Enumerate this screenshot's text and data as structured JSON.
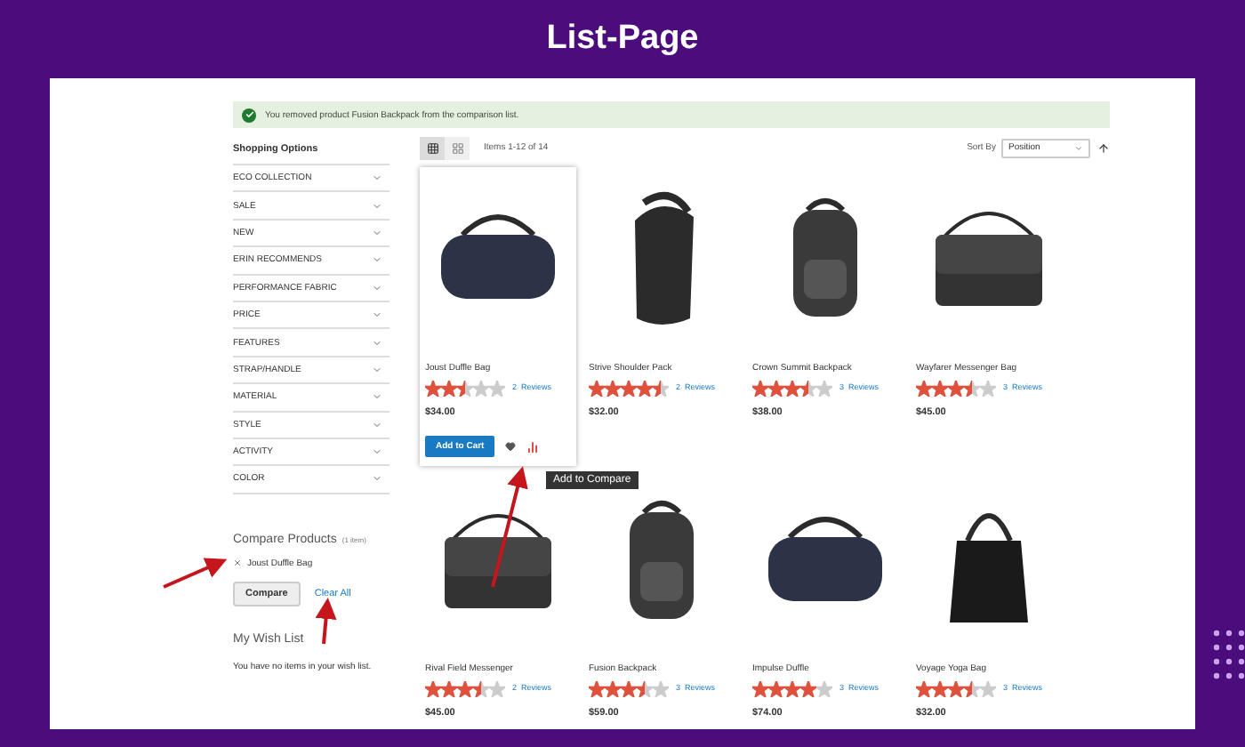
{
  "page_title": "List-Page",
  "message": {
    "text": "You removed product Fusion Backpack from the comparison list."
  },
  "sidebar": {
    "title": "Shopping Options",
    "filters": [
      {
        "label": "ECO COLLECTION"
      },
      {
        "label": "SALE"
      },
      {
        "label": "NEW"
      },
      {
        "label": "ERIN RECOMMENDS"
      },
      {
        "label": "PERFORMANCE FABRIC"
      },
      {
        "label": "PRICE"
      },
      {
        "label": "FEATURES"
      },
      {
        "label": "STRAP/HANDLE"
      },
      {
        "label": "MATERIAL"
      },
      {
        "label": "STYLE"
      },
      {
        "label": "ACTIVITY"
      },
      {
        "label": "COLOR"
      }
    ]
  },
  "compare": {
    "title": "Compare Products",
    "count": "(1 item)",
    "items": [
      {
        "name": "Joust Duffle Bag"
      }
    ],
    "compare_button": "Compare",
    "clear_all": "Clear All"
  },
  "wishlist": {
    "title": "My Wish List",
    "text": "You have no items in your wish list."
  },
  "toolbar": {
    "views": [
      {
        "kind": "grid",
        "selected": true
      },
      {
        "kind": "list",
        "selected": false
      }
    ],
    "items_count": "Items 1-12 of 14",
    "sort_label": "Sort By",
    "sort_value": "Position"
  },
  "products": [
    {
      "kind": "duffle",
      "name": "Joust Duffle Bag",
      "stars": 2.5,
      "reviews": "2  Reviews",
      "price": "$34.00",
      "hovered": true
    },
    {
      "kind": "sling",
      "name": "Strive Shoulder Pack",
      "stars": 4.5,
      "reviews": "2  Reviews",
      "price": "$32.00",
      "hovered": false
    },
    {
      "kind": "backpack",
      "name": "Crown Summit Backpack",
      "stars": 3.5,
      "reviews": "3  Reviews",
      "price": "$38.00",
      "hovered": false
    },
    {
      "kind": "messenger",
      "name": "Wayfarer Messenger Bag",
      "stars": 3.5,
      "reviews": "3  Reviews",
      "price": "$45.00",
      "hovered": false
    },
    {
      "kind": "messenger",
      "name": "Rival Field Messenger",
      "stars": 3.5,
      "reviews": "2  Reviews",
      "price": "$45.00",
      "hovered": false
    },
    {
      "kind": "backpack",
      "name": "Fusion Backpack",
      "stars": 3.5,
      "reviews": "3  Reviews",
      "price": "$59.00",
      "hovered": false
    },
    {
      "kind": "duffle",
      "name": "Impulse Duffle",
      "stars": 4,
      "reviews": "3  Reviews",
      "price": "$74.00",
      "hovered": false
    },
    {
      "kind": "tote",
      "name": "Voyage Yoga Bag",
      "stars": 3.5,
      "reviews": "3  Reviews",
      "price": "$32.00",
      "hovered": false
    }
  ],
  "hover_actions": {
    "add_to_cart": "Add to Cart",
    "tooltip": "Add to Compare"
  }
}
